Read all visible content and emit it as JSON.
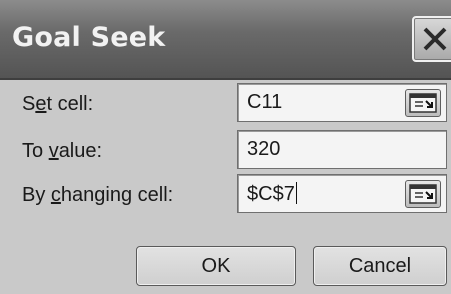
{
  "dialog": {
    "title": "Goal Seek",
    "close_label": "close"
  },
  "fields": {
    "set_cell": {
      "label_pre": "S",
      "label_ul": "e",
      "label_post": "t cell:",
      "value": "C11"
    },
    "to_value": {
      "label_pre": "To ",
      "label_ul": "v",
      "label_post": "alue:",
      "value": "320"
    },
    "by_changing_cell": {
      "label_pre": "By ",
      "label_ul": "c",
      "label_post": "hanging cell:",
      "value": "$C$7"
    }
  },
  "buttons": {
    "ok": "OK",
    "cancel": "Cancel"
  },
  "icons": {
    "close": "close-icon",
    "collapse_dialog": "collapse-dialog-icon"
  }
}
